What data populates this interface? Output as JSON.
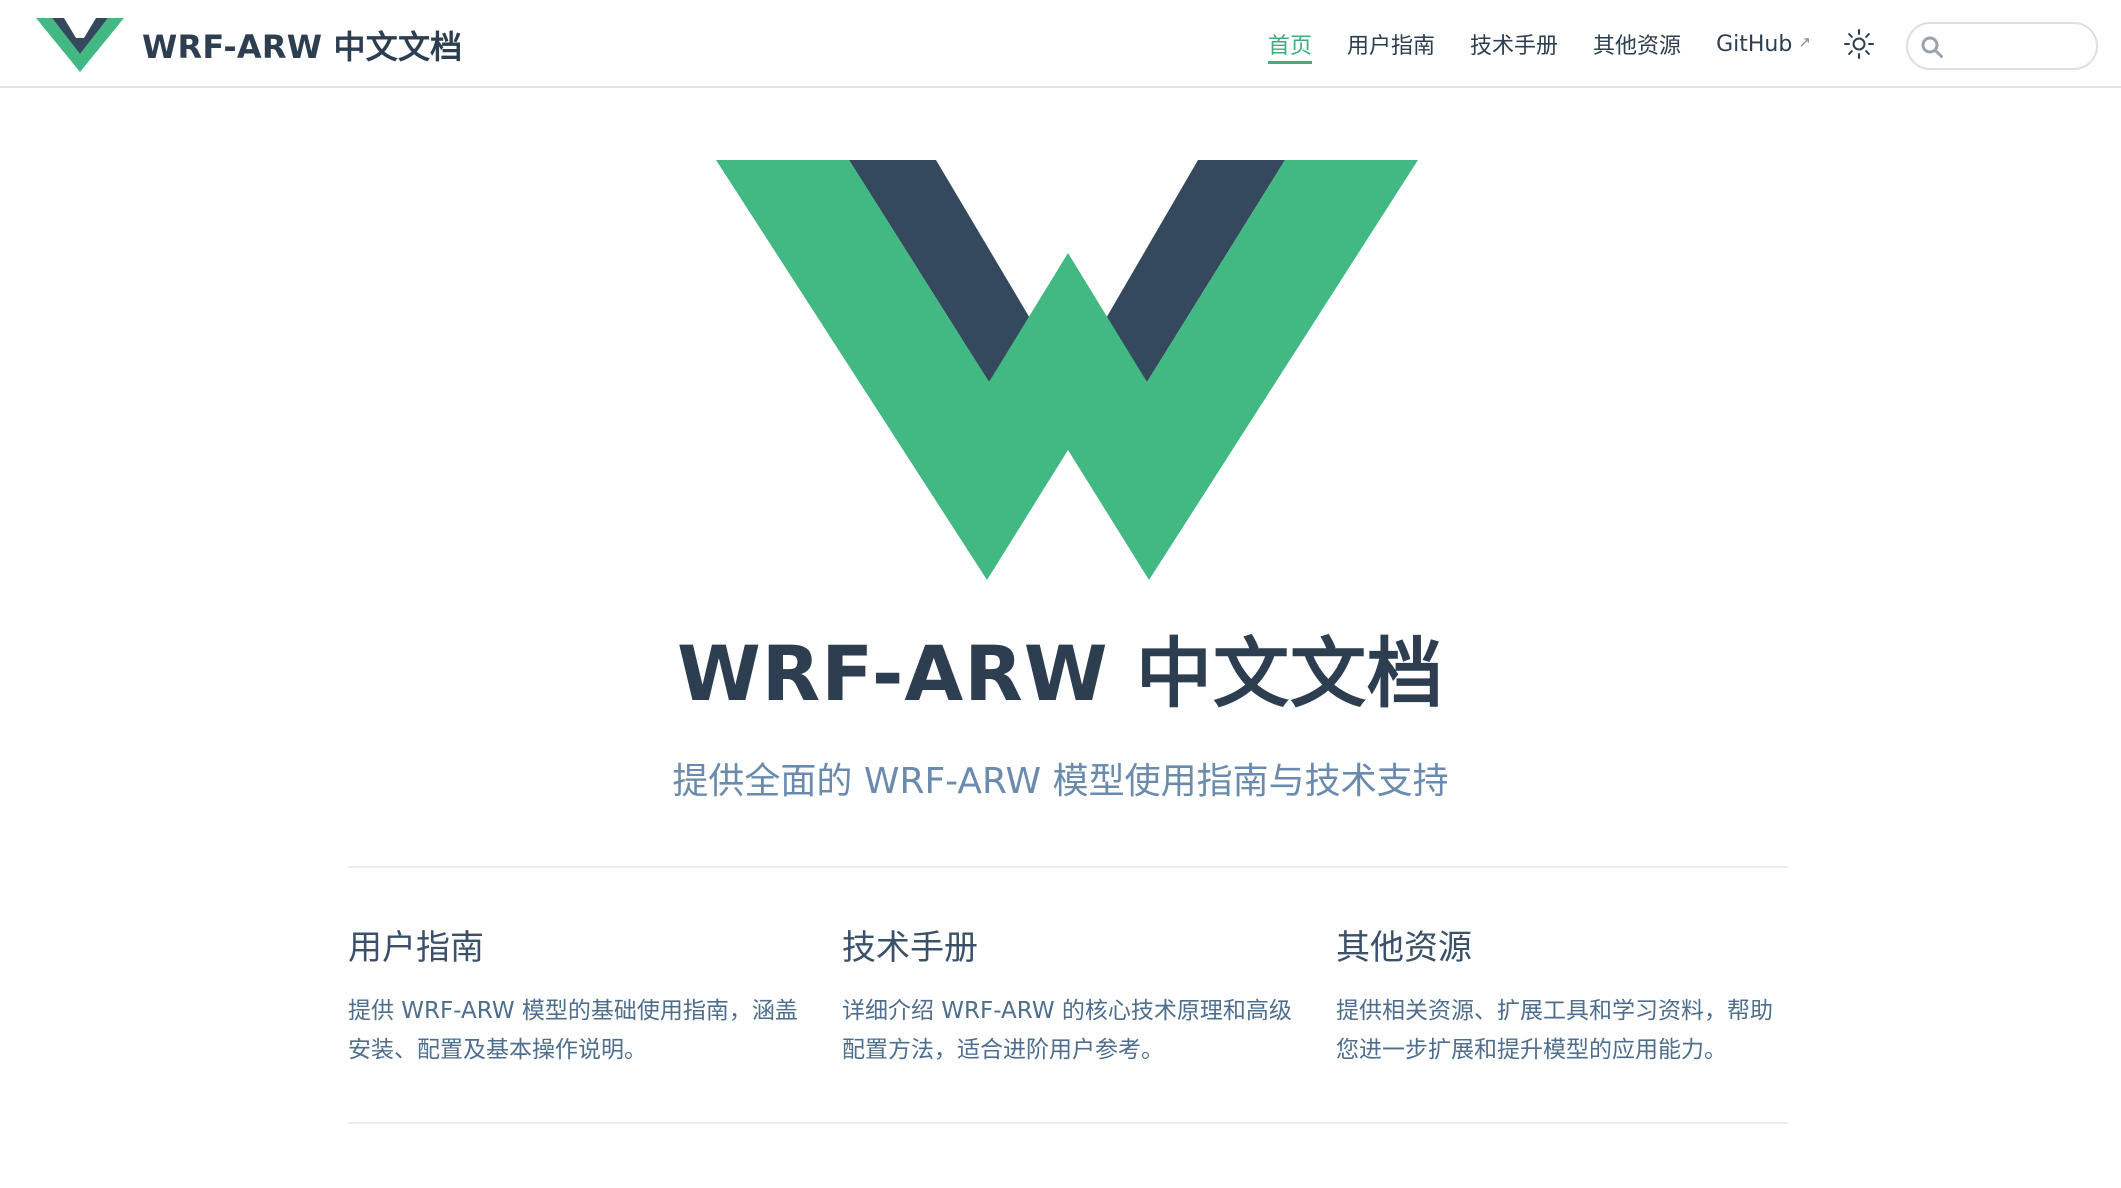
{
  "site": {
    "title": "WRF-ARW 中文文档"
  },
  "nav": {
    "items": [
      {
        "label": "首页",
        "active": true
      },
      {
        "label": "用户指南",
        "active": false
      },
      {
        "label": "技术手册",
        "active": false
      },
      {
        "label": "其他资源",
        "active": false
      },
      {
        "label": "GitHub",
        "active": false,
        "external": true
      }
    ],
    "external_icon": "↗",
    "theme_toggle_icon": "sun-icon",
    "search": {
      "placeholder": "",
      "value": "",
      "icon": "search-icon"
    }
  },
  "hero": {
    "title": "WRF-ARW 中文文档",
    "tagline": "提供全面的 WRF-ARW 模型使用指南与技术支持"
  },
  "features": [
    {
      "title": "用户指南",
      "details": "提供 WRF-ARW 模型的基础使用指南，涵盖安装、配置及基本操作说明。"
    },
    {
      "title": "技术手册",
      "details": "详细介绍 WRF-ARW 的核心技术原理和高级配置方法，适合进阶用户参考。"
    },
    {
      "title": "其他资源",
      "details": "提供相关资源、扩展工具和学习资料，帮助您进一步扩展和提升模型的应用能力。"
    }
  ],
  "colors": {
    "brand_green": "#42b883",
    "brand_dark": "#35495e",
    "accent": "#3eaf7c",
    "text": "#2c3e50"
  }
}
